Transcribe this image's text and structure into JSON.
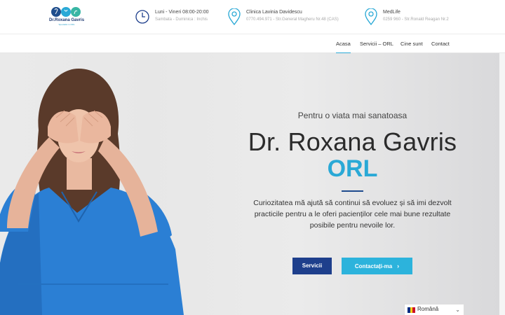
{
  "logo": {
    "title": "Dr.Roxana Gavris",
    "subtitle": "Specialist in ORL"
  },
  "header": {
    "hours": {
      "line1": "Luni - Vineri 08:00-20:00",
      "line2": "Sambata - Duminica : Inchis",
      "icon": "clock-icon"
    },
    "clinic1": {
      "line1": "Clinica Lavinia Davidescu",
      "line2": "0770.494.971 - Str.General Magheru Nr.48 (CAS)",
      "icon": "location-pin-icon"
    },
    "clinic2": {
      "line1": "MedLife",
      "line2": "0259 960 - Str.Ronald Reagan Nr.2",
      "icon": "location-pin-icon"
    }
  },
  "nav": {
    "items": [
      "Acasa",
      "Servicii – ORL",
      "Cine sunt",
      "Contact"
    ],
    "active": "Acasa"
  },
  "hero": {
    "tagline": "Pentru o viata mai sanatoasa",
    "name": "Dr. Roxana Gavris",
    "specialty": "ORL",
    "description": "Curiozitatea mă ajută să continui să evoluez și să imi dezvolt practicile pentru a le oferi pacienților cele mai bune rezultate posibile pentru nevoile lor.",
    "btn_services": "Servicii",
    "btn_contact": "Contactați-ma"
  },
  "language": {
    "selected": "Română"
  },
  "colors": {
    "navy": "#1e3f8c",
    "accent": "#2aa9d6",
    "button_light": "#2cb3dc"
  }
}
